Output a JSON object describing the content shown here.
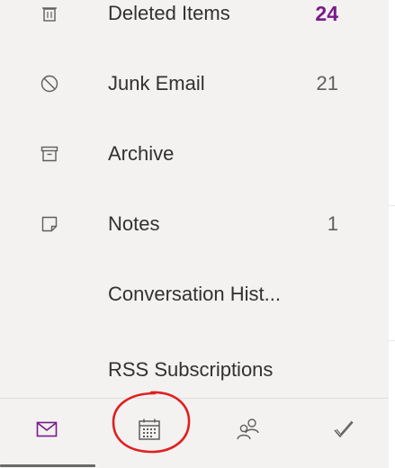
{
  "folders": [
    {
      "name": "Deleted Items",
      "count": "24",
      "icon": "trash-icon"
    },
    {
      "name": "Junk Email",
      "count": "21",
      "icon": "block-icon"
    },
    {
      "name": "Archive",
      "count": "",
      "icon": "archive-icon"
    },
    {
      "name": "Notes",
      "count": "1",
      "icon": "note-icon"
    },
    {
      "name": "Conversation Hist...",
      "count": "",
      "icon": ""
    },
    {
      "name": "RSS Subscriptions",
      "count": "",
      "icon": ""
    }
  ],
  "nav": {
    "items": [
      {
        "icon": "mail-icon",
        "active": true
      },
      {
        "icon": "calendar-icon",
        "active": false
      },
      {
        "icon": "people-icon",
        "active": false
      },
      {
        "icon": "check-icon",
        "active": false
      }
    ]
  },
  "colors": {
    "accent": "#7a1a8a",
    "pane_bg": "#f3f2f1",
    "text": "#323130",
    "icon": "#605e5c",
    "annotation": "#e02020"
  }
}
